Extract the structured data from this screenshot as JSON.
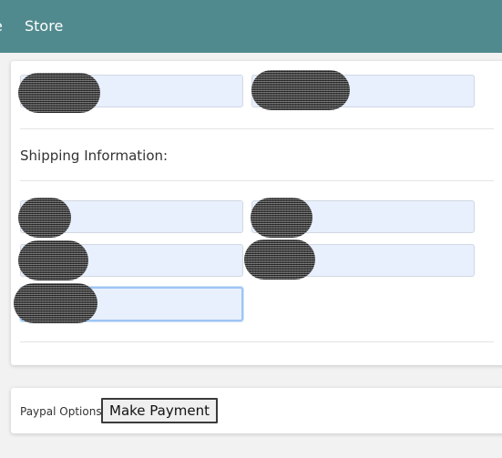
{
  "navbar": {
    "cut_text": "e",
    "store_label": "Store",
    "background": "#518a8e"
  },
  "form": {
    "shipping_heading": "Shipping Information:",
    "fields_state": "redacted"
  },
  "payment": {
    "options_label": "Paypal Options",
    "button_label": "Make Payment"
  }
}
